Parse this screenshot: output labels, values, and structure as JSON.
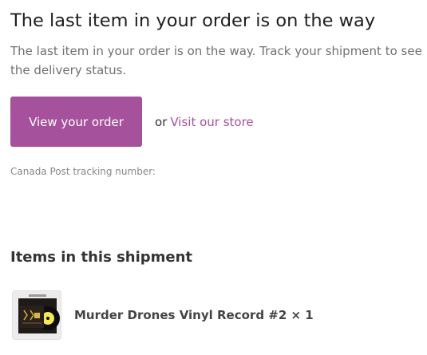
{
  "header": {
    "title": "The last item in your order is on the way",
    "subtitle": "The last item in your order is on the way. Track your shipment to see the delivery status."
  },
  "actions": {
    "view_order_label": "View your order",
    "or_text": "or",
    "visit_store_label": "Visit our store"
  },
  "tracking": {
    "label": "Canada Post tracking number:"
  },
  "shipment": {
    "section_title": "Items in this shipment",
    "items": [
      {
        "name": "Murder Drones Vinyl Record #2 × 1",
        "thumbnail_icon": "vinyl-record-cover-icon"
      }
    ]
  },
  "colors": {
    "accent": "#a6519b",
    "text": "#333333",
    "muted": "#707070"
  }
}
